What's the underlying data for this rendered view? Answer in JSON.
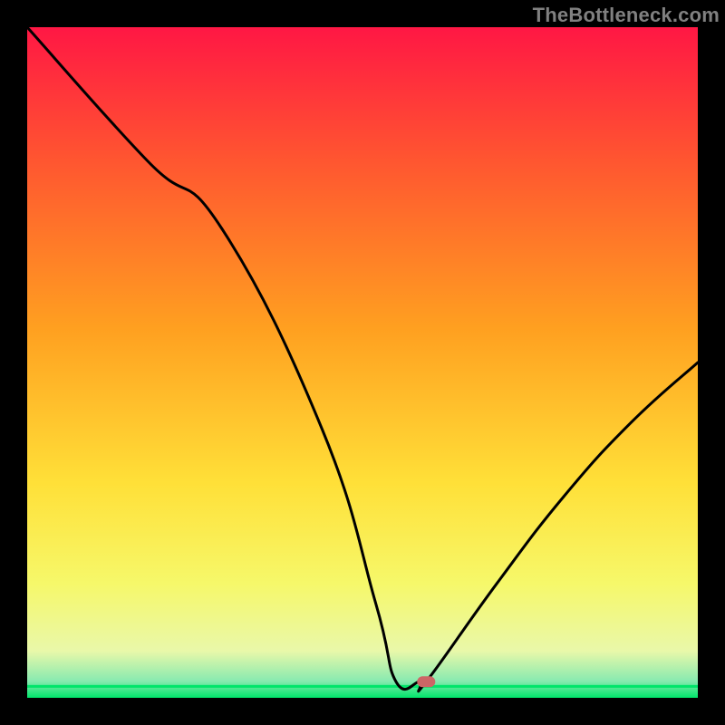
{
  "watermark": "TheBottleneck.com",
  "chart_data": {
    "type": "line",
    "series": [
      {
        "name": "left-curve",
        "x": [
          0.0,
          0.18,
          0.29,
          0.44,
          0.52,
          0.55,
          0.585,
          0.595
        ],
        "y": [
          1.0,
          0.8,
          0.7,
          0.4,
          0.14,
          0.024,
          0.024,
          0.024
        ]
      },
      {
        "name": "right-curve",
        "x": [
          0.595,
          0.7,
          0.8,
          0.9,
          1.0
        ],
        "y": [
          0.024,
          0.17,
          0.3,
          0.41,
          0.5
        ]
      }
    ],
    "marker": {
      "x": 0.595,
      "y": 0.024,
      "color": "#cc6666",
      "name": "bottleneck-point"
    },
    "baseline": {
      "y": 0.017,
      "color": "#00e56a"
    },
    "gradient_stops": [
      {
        "offset": 0.0,
        "color": "#ff1744"
      },
      {
        "offset": 0.2,
        "color": "#ff5630"
      },
      {
        "offset": 0.45,
        "color": "#ffa020"
      },
      {
        "offset": 0.68,
        "color": "#ffe038"
      },
      {
        "offset": 0.83,
        "color": "#f6f86a"
      },
      {
        "offset": 0.93,
        "color": "#e9f8a9"
      },
      {
        "offset": 0.975,
        "color": "#88eab0"
      },
      {
        "offset": 1.0,
        "color": "#00e56a"
      }
    ],
    "xlim": [
      0,
      1
    ],
    "ylim": [
      0,
      1
    ],
    "title": "",
    "xlabel": "",
    "ylabel": ""
  }
}
